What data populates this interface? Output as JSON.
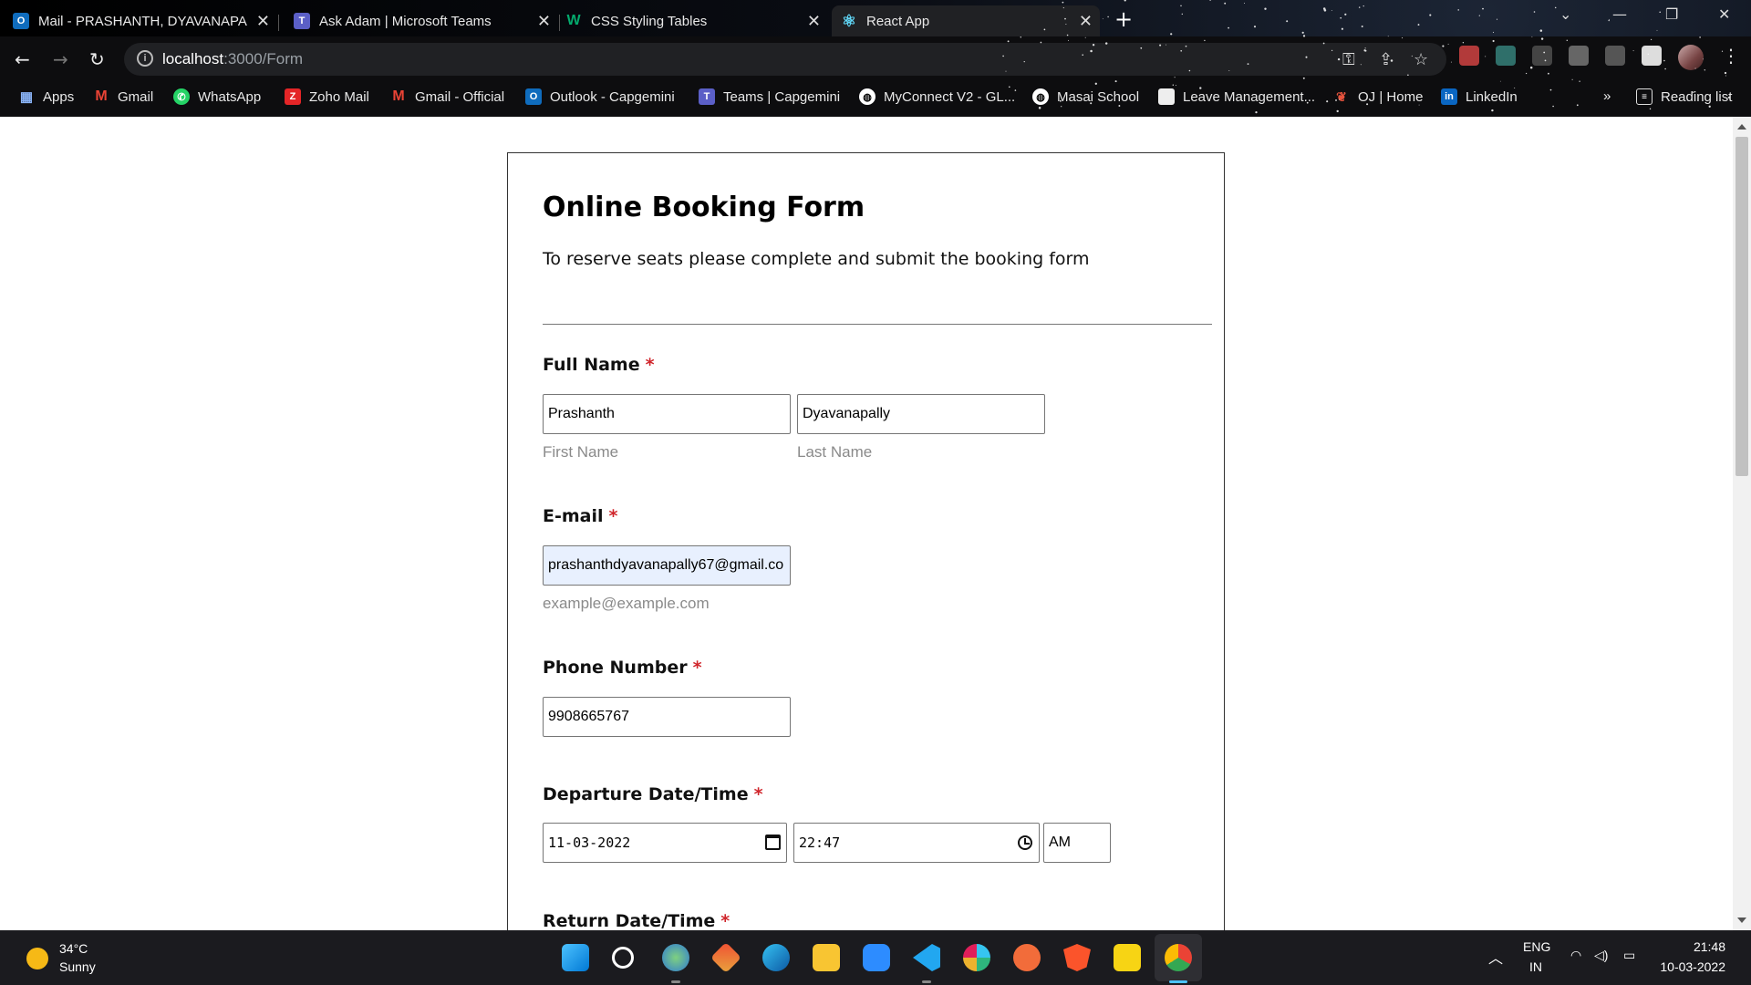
{
  "browser": {
    "tabs": [
      {
        "title": "Mail - PRASHANTH, DYAVANAPA",
        "icon": "outlook-icon"
      },
      {
        "title": "Ask Adam | Microsoft Teams",
        "icon": "teams-icon"
      },
      {
        "title": "CSS Styling Tables",
        "icon": "w3schools-icon"
      },
      {
        "title": "React App",
        "icon": "react-icon"
      }
    ],
    "url_host": "localhost",
    "url_path": ":3000/Form",
    "bookmarks": [
      {
        "label": "Apps",
        "icon": "apps-grid-icon"
      },
      {
        "label": "Gmail",
        "icon": "gmail-icon"
      },
      {
        "label": "WhatsApp",
        "icon": "whatsapp-icon"
      },
      {
        "label": "Zoho Mail",
        "icon": "zoho-icon"
      },
      {
        "label": "Gmail - Official",
        "icon": "gmail-icon"
      },
      {
        "label": "Outlook - Capgemini",
        "icon": "outlook-icon"
      },
      {
        "label": "Teams | Capgemini",
        "icon": "teams-icon"
      },
      {
        "label": "MyConnect V2 - GL...",
        "icon": "globe-icon"
      },
      {
        "label": "Masai School",
        "icon": "globe-icon"
      },
      {
        "label": "Leave Management...",
        "icon": "document-icon"
      },
      {
        "label": "OJ | Home",
        "icon": "oj-icon"
      },
      {
        "label": "LinkedIn",
        "icon": "linkedin-icon"
      }
    ],
    "more_bookmarks": "»",
    "reading_list": "Reading list"
  },
  "form": {
    "title": "Online Booking Form",
    "subtitle": "To reserve seats please complete and submit the booking form",
    "required_mark": "*",
    "full_name": {
      "label": "Full Name",
      "first_value": "Prashanth",
      "first_hint": "First Name",
      "last_value": "Dyavanapally",
      "last_hint": "Last Name"
    },
    "email": {
      "label": "E-mail",
      "value": "prashanthdyavanapally67@gmail.co",
      "hint": "example@example.com"
    },
    "phone": {
      "label": "Phone Number",
      "value": "9908665767"
    },
    "departure": {
      "label": "Departure Date/Time",
      "date": "11-03-2022",
      "time": "22:47",
      "ampm": "AM"
    },
    "return": {
      "label": "Return Date/Time"
    }
  },
  "taskbar": {
    "temperature": "34°C",
    "weather": "Sunny",
    "lang": "ENG",
    "region": "IN",
    "time": "21:48",
    "date": "10-03-2022"
  }
}
